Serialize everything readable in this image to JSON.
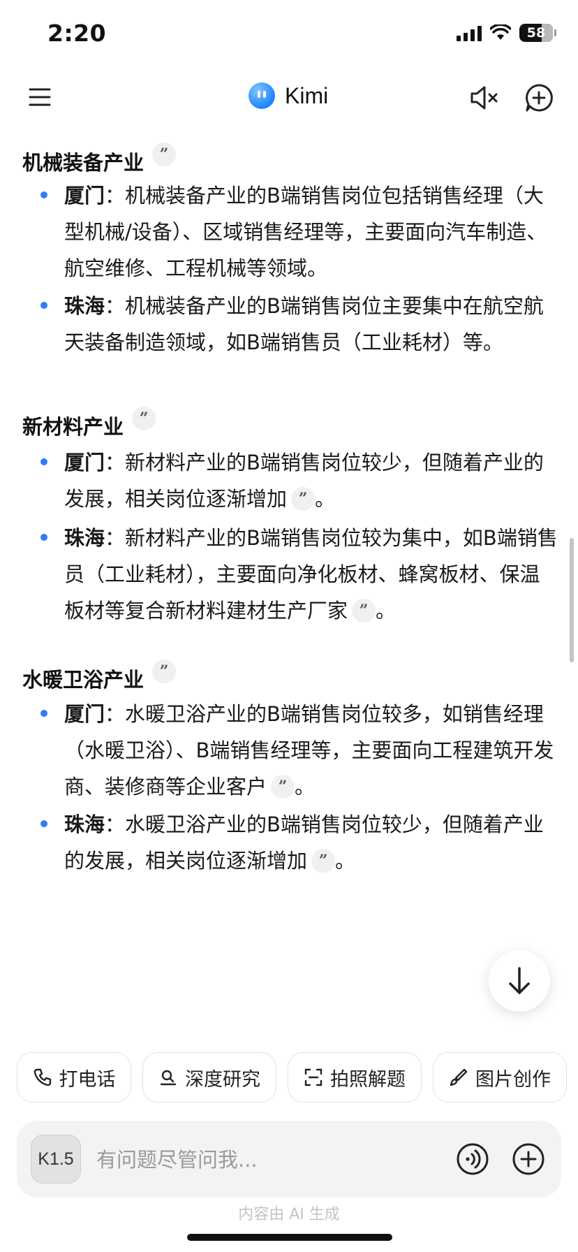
{
  "status_bar": {
    "time": "2:20",
    "battery": "58"
  },
  "header": {
    "title": "Kimi"
  },
  "quote_mark": "”",
  "sections": [
    {
      "title": "机械装备产业",
      "items": [
        {
          "city": "厦门",
          "sep": "：",
          "text": "机械装备产业的B端销售岗位包括销售经理（大型机械/设备）、区域销售经理等，主要面向汽车制造、航空维修、工程机械等领域。"
        },
        {
          "city": "珠海",
          "sep": "：",
          "text": "机械装备产业的B端销售岗位主要集中在航空航天装备制造领域，如B端销售员（工业耗材）等。"
        }
      ]
    },
    {
      "title": "新材料产业",
      "items": [
        {
          "city": "厦门",
          "sep": "：",
          "text": "新材料产业的B端销售岗位较少，但随着产业的发展，相关岗位逐渐增加",
          "end": "。"
        },
        {
          "city": "珠海",
          "sep": "：",
          "text": "新材料产业的B端销售岗位较为集中，如B端销售员（工业耗材），主要面向净化板材、蜂窝板材、保温板材等复合新材料建材生产厂家",
          "end": "。"
        }
      ]
    },
    {
      "title": "水暖卫浴产业",
      "items": [
        {
          "city": "厦门",
          "sep": "：",
          "text": "水暖卫浴产业的B端销售岗位较多，如销售经理（水暖卫浴）、B端销售经理等，主要面向工程建筑开发商、装修商等企业客户",
          "end": "。"
        },
        {
          "city": "珠海",
          "sep": "：",
          "text": "水暖卫浴产业的B端销售岗位较少，但随着产业的发展，相关岗位逐渐增加",
          "end": "。"
        }
      ]
    }
  ],
  "quick_actions": [
    {
      "label": "打电话",
      "icon": "phone-icon"
    },
    {
      "label": "深度研究",
      "icon": "research-icon"
    },
    {
      "label": "拍照解题",
      "icon": "scan-icon"
    },
    {
      "label": "图片创作",
      "icon": "brush-icon"
    }
  ],
  "input": {
    "model": "K1.5",
    "placeholder": "有问题尽管问我..."
  },
  "footer_note": "内容由 AI 生成",
  "colors": {
    "accent": "#2d7df6",
    "brand": "#1f83ff"
  }
}
